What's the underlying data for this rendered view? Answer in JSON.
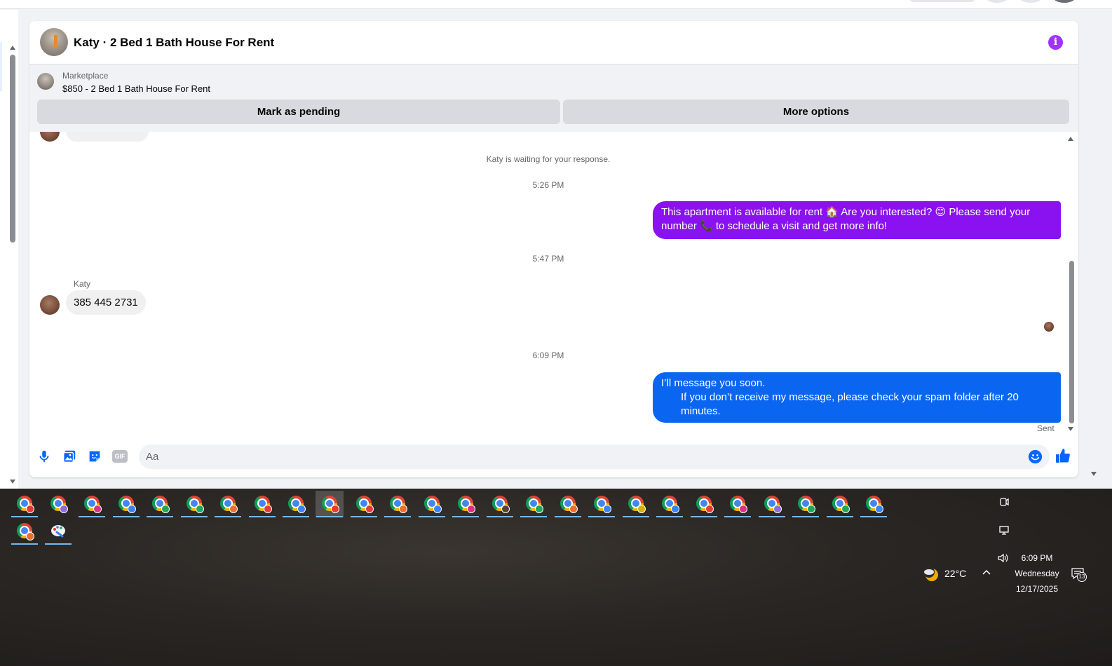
{
  "chat": {
    "title": "Katy · 2 Bed 1 Bath House For Rent",
    "marketplace_label": "Marketplace",
    "listing": "$850 - 2 Bed 1 Bath House For Rent",
    "mark_pending_label": "Mark as pending",
    "more_options_label": "More options"
  },
  "messages": {
    "waiting_notice": "Katy is waiting for your response.",
    "time_1": "5:26 PM",
    "outgoing_1": "This apartment is available for rent 🏠 Are you interested? 😊 Please send your number 📞 to schedule a visit and get more info!",
    "time_2": "5:47 PM",
    "sender_name": "Katy",
    "incoming_1": "385 445 2731",
    "time_3": "6:09 PM",
    "outgoing_2_line1": "I’ll message you soon.",
    "outgoing_2_line2": "If you don’t receive my message, please check your spam folder after 20 minutes.",
    "status": "Sent"
  },
  "composer": {
    "placeholder": "Aa",
    "gif_label": "GIF",
    "icons": [
      "microphone-icon",
      "photo-icon",
      "sticker-icon",
      "gif-icon",
      "emoji-icon",
      "thumbs-up-icon"
    ]
  },
  "colors": {
    "purple_bubble": "#8a11f0",
    "blue_bubble": "#0a66f0",
    "accent": "#0866ff",
    "info": "#a033ff"
  },
  "taskbar": {
    "weather_temp": "22°C",
    "time": "6:09 PM",
    "day": "Wednesday",
    "date": "12/17/2025",
    "notification_count": "13"
  }
}
